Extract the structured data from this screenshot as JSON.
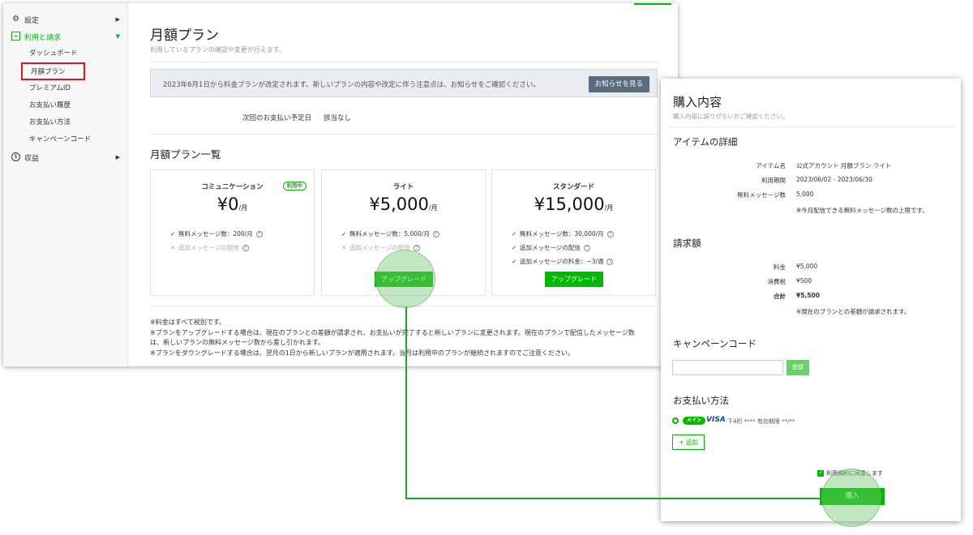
{
  "sidebar": {
    "settings_label": "設定",
    "billing_label": "利用と請求",
    "dashboard_label": "ダッシュボード",
    "monthly_plan_label": "月額プラン",
    "premium_id_label": "プレミアムID",
    "payment_history_label": "お支払い履歴",
    "payment_method_label": "お支払い方法",
    "campaign_code_label": "キャンペーンコード",
    "revenue_label": "収益"
  },
  "page": {
    "title": "月額プラン",
    "subtitle": "利用しているプランの確認や変更が行えます。",
    "notice_text": "2023年6月1日から料金プランが改定されます。新しいプランの内容や改定に伴う注意点は、お知らせをご確認ください。",
    "notice_button": "お知らせを見る",
    "next_payment_label": "次回のお支払い予定日",
    "next_payment_value": "該当なし",
    "plans_heading": "月額プラン一覧",
    "notes": [
      "※料金はすべて税別です。",
      "※プランをアップグレードする場合は、現在のプランとの差額が請求され、お支払いが完了すると新しいプランに変更されます。現在のプランで配信したメッセージ数",
      "は、新しいプランの無料メッセージ数から差し引かれます。",
      "※プランをダウングレードする場合は、翌月の1日から新しいプランが適用されます。当月は利用中のプランが継続されますのでご注意ください。"
    ]
  },
  "plans": {
    "communication": {
      "name": "コミュニケーション",
      "badge": "利用中",
      "price": "¥0",
      "unit": "/月",
      "feature_1_mark": "✓",
      "feature_1": "無料メッセージ数：200/月",
      "feature_2_mark": "✕",
      "feature_2": "追加メッセージの配信"
    },
    "light": {
      "name": "ライト",
      "price": "¥5,000",
      "unit": "/月",
      "feature_1_mark": "✓",
      "feature_1": "無料メッセージ数：5,000/月",
      "feature_2_mark": "✕",
      "feature_2": "追加メッセージの配信",
      "button": "アップグレード"
    },
    "standard": {
      "name": "スタンダード",
      "price": "¥15,000",
      "unit": "/月",
      "feature_1_mark": "✓",
      "feature_1": "無料メッセージ数：30,000/月",
      "feature_2_mark": "✓",
      "feature_2": "追加メッセージの配信",
      "feature_3_mark": "✓",
      "feature_3": "追加メッセージの料金：~3/通",
      "button": "アップグレード"
    }
  },
  "help_glyph": "?",
  "purchase": {
    "title": "購入内容",
    "subtitle": "購入内容に誤りがないかご確認ください。",
    "item_section": "アイテムの詳細",
    "item_name_label": "アイテム名",
    "item_name_value": "公式アカウント 月額プラン ライト",
    "period_label": "利用期間",
    "period_value": "2023/06/02 - 2023/06/30",
    "free_msg_label": "無料メッセージ数",
    "free_msg_value": "5,000",
    "free_msg_note": "※今月配信できる無料メッセージ数の上限です。",
    "billing_section": "請求額",
    "fee_label": "料金",
    "fee_value": "¥5,000",
    "tax_label": "消費税",
    "tax_value": "¥500",
    "total_label": "合計",
    "total_value": "¥5,500",
    "billing_note": "※現在のプランとの差額が請求されます。",
    "campaign_section": "キャンペーンコード",
    "campaign_input_value": "",
    "register_button": "登録",
    "payment_section": "お支払い方法",
    "main_badge": "メイン",
    "card_brand": "VISA",
    "card_info": "下4桁 **** 有効期限 **/**",
    "add_button": "+ 追加",
    "agree_label": "利用規約に同意します",
    "purchase_button": "購入"
  },
  "colors": {
    "accent": "#00b900",
    "highlight_box": "#e0161b",
    "notice_button": "#5c6a7f"
  }
}
